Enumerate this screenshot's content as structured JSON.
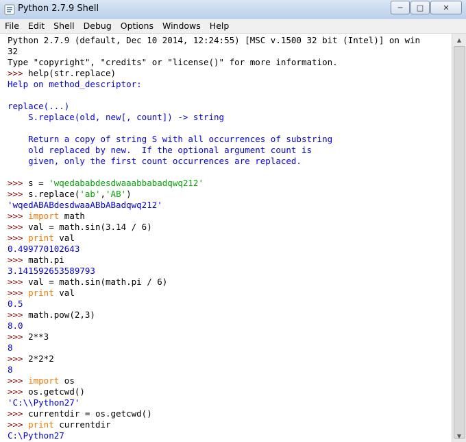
{
  "window": {
    "title": "Python 2.7.9 Shell",
    "minimize": "─",
    "maximize": "□",
    "close": "✕"
  },
  "menu": [
    "File",
    "Edit",
    "Shell",
    "Debug",
    "Options",
    "Windows",
    "Help"
  ],
  "console": {
    "prompt": ">>> ",
    "lines": [
      {
        "parts": [
          {
            "t": "Python 2.7.9 (default, Dec 10 2014, 12:24:55) [MSC v.1500 32 bit (Intel)] on win",
            "c": "code"
          }
        ]
      },
      {
        "parts": [
          {
            "t": "32",
            "c": "code"
          }
        ]
      },
      {
        "parts": [
          {
            "t": "Type \"copyright\", \"credits\" or \"license()\" for more information.",
            "c": "code"
          }
        ]
      },
      {
        "prompt": true,
        "parts": [
          {
            "t": "help(str.replace)",
            "c": "code"
          }
        ]
      },
      {
        "parts": [
          {
            "t": "Help on method_descriptor:",
            "c": "out"
          }
        ]
      },
      {
        "parts": [
          {
            "t": "",
            "c": "out"
          }
        ]
      },
      {
        "parts": [
          {
            "t": "replace(...)",
            "c": "out"
          }
        ]
      },
      {
        "parts": [
          {
            "t": "    S.replace(old, new[, count]) -> string",
            "c": "out"
          }
        ]
      },
      {
        "parts": [
          {
            "t": "",
            "c": "out"
          }
        ]
      },
      {
        "parts": [
          {
            "t": "    Return a copy of string S with all occurrences of substring",
            "c": "out"
          }
        ]
      },
      {
        "parts": [
          {
            "t": "    old replaced by new.  If the optional argument count is",
            "c": "out"
          }
        ]
      },
      {
        "parts": [
          {
            "t": "    given, only the first count occurrences are replaced.",
            "c": "out"
          }
        ]
      },
      {
        "parts": [
          {
            "t": "",
            "c": "out"
          }
        ]
      },
      {
        "prompt": true,
        "parts": [
          {
            "t": "s = ",
            "c": "code"
          },
          {
            "t": "'wqedababdesdwaaabbabadqwq212'",
            "c": "str"
          }
        ]
      },
      {
        "prompt": true,
        "parts": [
          {
            "t": "s.replace(",
            "c": "code"
          },
          {
            "t": "'ab'",
            "c": "str"
          },
          {
            "t": ",",
            "c": "code"
          },
          {
            "t": "'AB'",
            "c": "str"
          },
          {
            "t": ")",
            "c": "code"
          }
        ]
      },
      {
        "parts": [
          {
            "t": "'wqedABABdesdwaaABbABadqwq212'",
            "c": "out"
          }
        ]
      },
      {
        "prompt": true,
        "parts": [
          {
            "t": "import",
            "c": "kw"
          },
          {
            "t": " math",
            "c": "code"
          }
        ]
      },
      {
        "prompt": true,
        "parts": [
          {
            "t": "val = math.sin(3.14 / 6)",
            "c": "code"
          }
        ]
      },
      {
        "prompt": true,
        "parts": [
          {
            "t": "print",
            "c": "kw"
          },
          {
            "t": " val",
            "c": "code"
          }
        ]
      },
      {
        "parts": [
          {
            "t": "0.499770102643",
            "c": "out"
          }
        ]
      },
      {
        "prompt": true,
        "parts": [
          {
            "t": "math.pi",
            "c": "code"
          }
        ]
      },
      {
        "parts": [
          {
            "t": "3.141592653589793",
            "c": "out"
          }
        ]
      },
      {
        "prompt": true,
        "parts": [
          {
            "t": "val = math.sin(math.pi / 6)",
            "c": "code"
          }
        ]
      },
      {
        "prompt": true,
        "parts": [
          {
            "t": "print",
            "c": "kw"
          },
          {
            "t": " val",
            "c": "code"
          }
        ]
      },
      {
        "parts": [
          {
            "t": "0.5",
            "c": "out"
          }
        ]
      },
      {
        "prompt": true,
        "parts": [
          {
            "t": "math.pow(2,3)",
            "c": "code"
          }
        ]
      },
      {
        "parts": [
          {
            "t": "8.0",
            "c": "out"
          }
        ]
      },
      {
        "prompt": true,
        "parts": [
          {
            "t": "2**3",
            "c": "code"
          }
        ]
      },
      {
        "parts": [
          {
            "t": "8",
            "c": "out"
          }
        ]
      },
      {
        "prompt": true,
        "parts": [
          {
            "t": "2*2*2",
            "c": "code"
          }
        ]
      },
      {
        "parts": [
          {
            "t": "8",
            "c": "out"
          }
        ]
      },
      {
        "prompt": true,
        "parts": [
          {
            "t": "import",
            "c": "kw"
          },
          {
            "t": " os",
            "c": "code"
          }
        ]
      },
      {
        "prompt": true,
        "parts": [
          {
            "t": "os.getcwd()",
            "c": "code"
          }
        ]
      },
      {
        "parts": [
          {
            "t": "'C:\\\\Python27'",
            "c": "out"
          }
        ]
      },
      {
        "prompt": true,
        "parts": [
          {
            "t": "currentdir = os.getcwd()",
            "c": "code"
          }
        ]
      },
      {
        "prompt": true,
        "parts": [
          {
            "t": "print",
            "c": "kw"
          },
          {
            "t": " currentdir",
            "c": "code"
          }
        ]
      },
      {
        "parts": [
          {
            "t": "C:\\Python27",
            "c": "out"
          }
        ]
      }
    ]
  },
  "scrollbar": {
    "up": "▲",
    "down": "▼"
  }
}
